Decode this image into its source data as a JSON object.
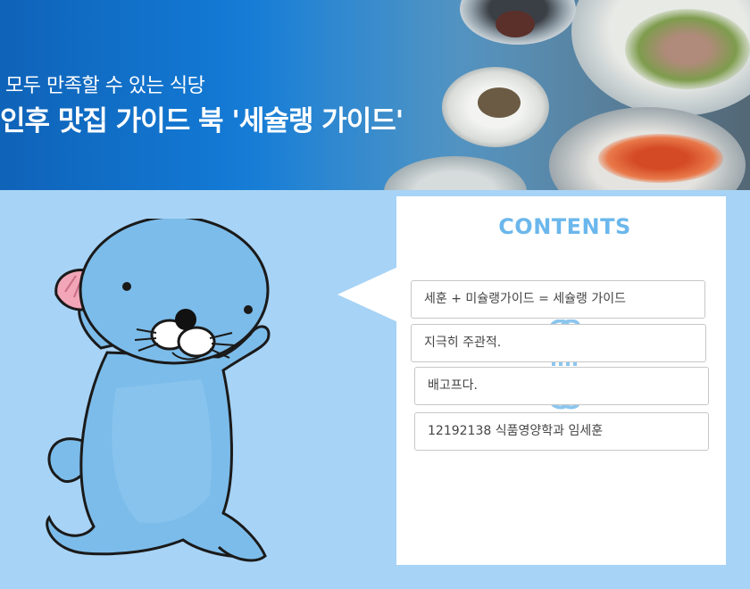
{
  "banner": {
    "line1": "모두 만족할 수 있는 식당",
    "line2": "인후 맛집 가이드 북 '세슐랭 가이드'"
  },
  "contents": {
    "title": "CONTENTS",
    "items": [
      "세훈 + 미슐랭가이드 = 세슐랭 가이드",
      "지극히 주관적.",
      "배고프다.",
      "12192138 식품영양학과 임세훈"
    ]
  },
  "colors": {
    "page_background": "#a7d3f6",
    "banner_blue": "#1379d4",
    "title_blue": "#6bb7ec",
    "mascot_blue": "#7cbcea"
  }
}
